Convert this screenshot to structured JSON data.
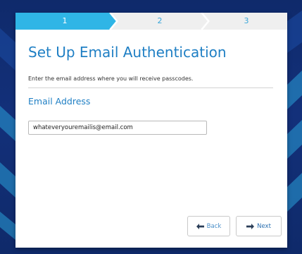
{
  "wizard": {
    "steps": [
      {
        "label": "1",
        "active": true
      },
      {
        "label": "2",
        "active": false
      },
      {
        "label": "3",
        "active": false
      }
    ],
    "title": "Set Up Email Authentication",
    "subtitle": "Enter the email address where you will receive passcodes.",
    "field_label": "Email Address",
    "email_value": "whateveryouremailis@email.com",
    "back_label": "Back",
    "next_label": "Next",
    "back_icon": "arrow-left-icon",
    "next_icon": "arrow-right-icon"
  },
  "colors": {
    "accent": "#1f7fc4",
    "step_active": "#2fb5e6",
    "step_inactive": "#eeeeee",
    "background": "#13307a"
  }
}
